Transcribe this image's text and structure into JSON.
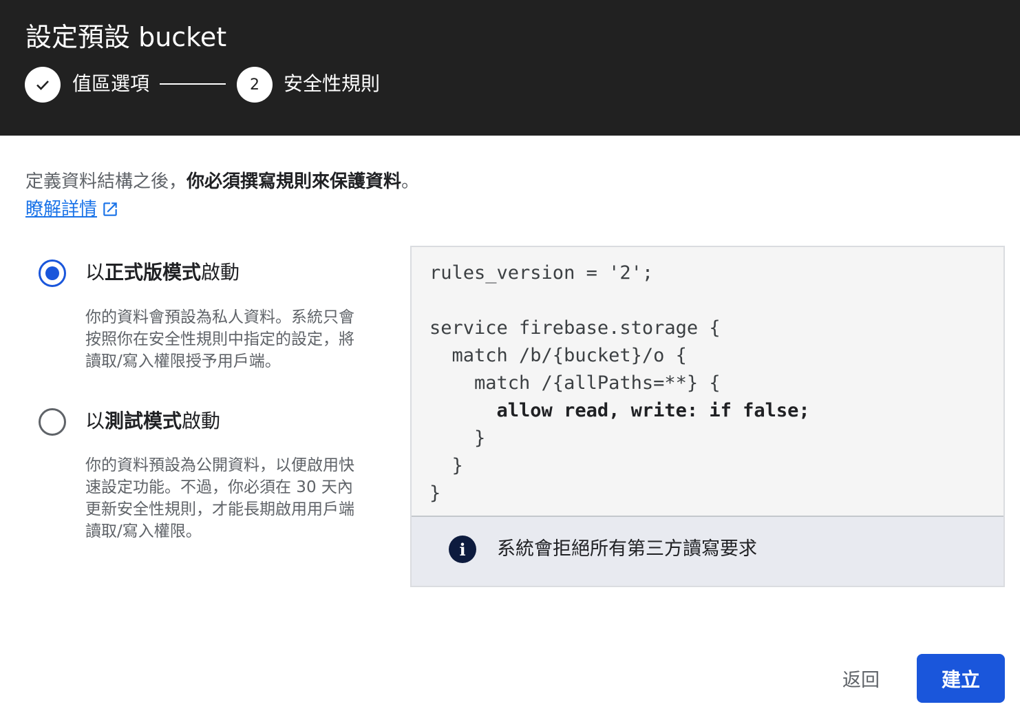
{
  "header": {
    "title": "設定預設 bucket",
    "steps": [
      {
        "number": "✓",
        "label": "值區選項",
        "status": "completed"
      },
      {
        "number": "2",
        "label": "安全性規則",
        "status": "current"
      }
    ]
  },
  "intro": {
    "text_prefix": "定義資料結構之後，",
    "text_bold": "你必須撰寫規則來保護資料",
    "text_suffix": "。",
    "learn_more": "瞭解詳情"
  },
  "options": [
    {
      "title_prefix": "以",
      "title_bold": "正式版模式",
      "title_suffix": "啟動",
      "selected": true,
      "description": "你的資料會預設為私人資料。系統只會按照你在安全性規則中指定的設定，將讀取/寫入權限授予用戶端。"
    },
    {
      "title_prefix": "以",
      "title_bold": "測試模式",
      "title_suffix": "啟動",
      "selected": false,
      "description": "你的資料預設為公開資料，以便啟用快速設定功能。不過，你必須在 30 天內更新安全性規則，才能長期啟用用戶端讀取/寫入權限。"
    }
  ],
  "code": {
    "lines": [
      "rules_version = '2';",
      "",
      "service firebase.storage {",
      "  match /b/{bucket}/o {",
      "    match /{allPaths=**} {",
      "      allow read, write: if false;",
      "    }",
      "  }",
      "}"
    ]
  },
  "info": {
    "icon": "info-icon",
    "text": "系統會拒絕所有第三方讀寫要求"
  },
  "actions": {
    "back_label": "返回",
    "create_label": "建立"
  },
  "colors": {
    "header_bg": "#212121",
    "accent": "#1a56db",
    "link": "#1a73e8"
  }
}
